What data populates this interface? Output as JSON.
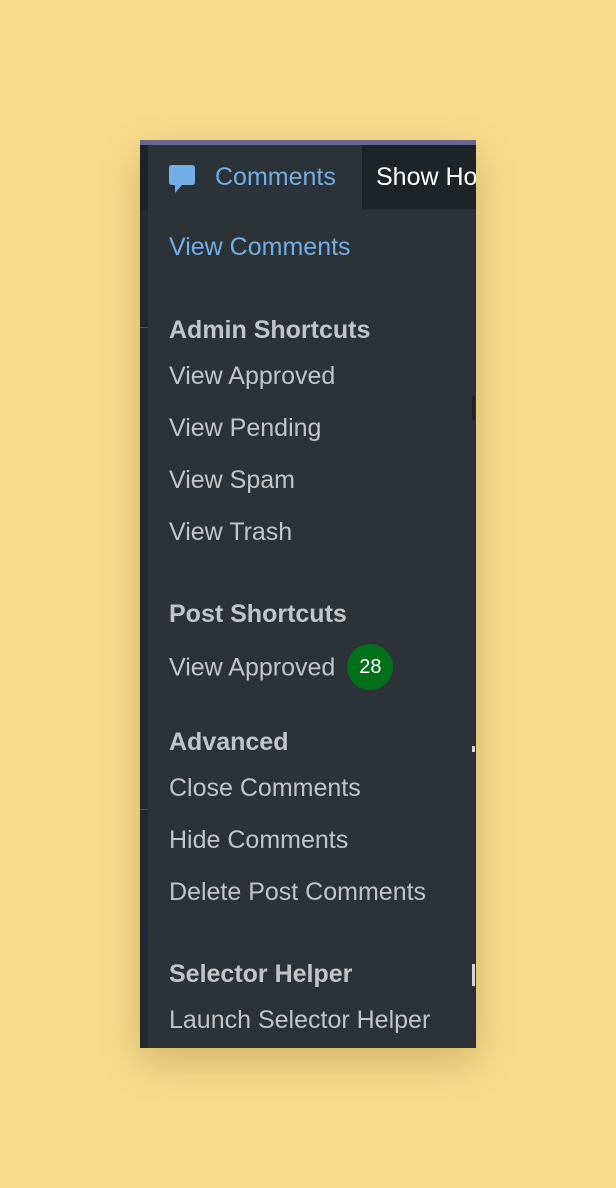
{
  "adminbar": {
    "comments_label": "Comments",
    "comments_icon": "speech-bubble-icon",
    "show_label": "Show Ho"
  },
  "menu": {
    "view_comments": "View Comments",
    "sections": [
      {
        "heading": "Admin Shortcuts",
        "items": [
          "View Approved",
          "View Pending",
          "View Spam",
          "View Trash"
        ]
      },
      {
        "heading": "Post Shortcuts",
        "items": [
          "View Approved"
        ],
        "badge": "28"
      },
      {
        "heading": "Advanced",
        "items": [
          "Close Comments",
          "Hide Comments",
          "Delete Post Comments"
        ]
      },
      {
        "heading": "Selector Helper",
        "items": [
          "Launch Selector Helper"
        ]
      }
    ]
  },
  "colors": {
    "background": "#f8dc8c",
    "adminbar": "#1d2327",
    "menu": "#2c3338",
    "link": "#72aee6",
    "text": "#c3c4c7",
    "badge": "#00701a"
  }
}
